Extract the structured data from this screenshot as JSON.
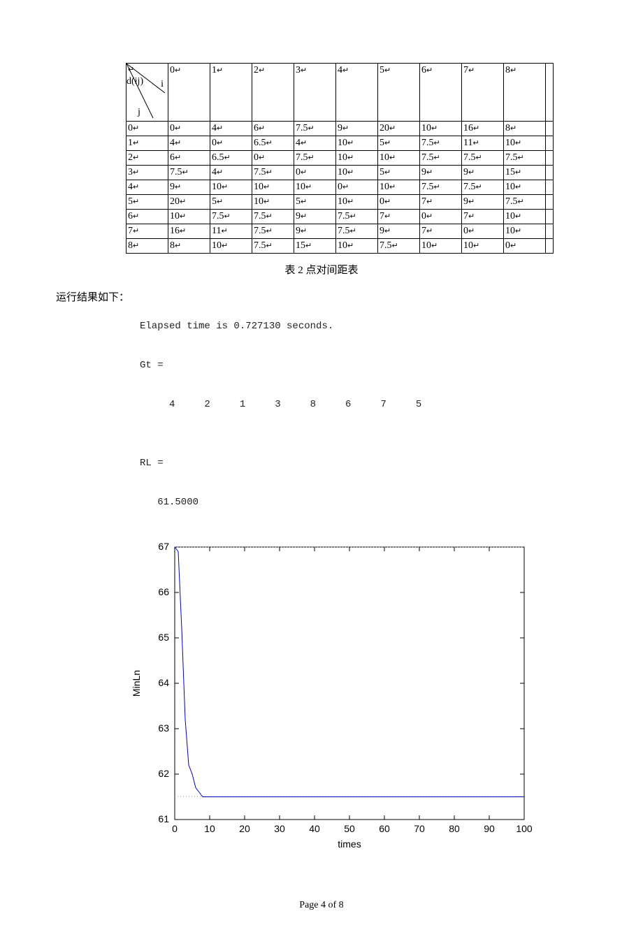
{
  "table": {
    "header_diag": {
      "dij": "d(ij)",
      "i": "i",
      "j": "j",
      "cr": "↵"
    },
    "col_headers": [
      "0",
      "1",
      "2",
      "3",
      "4",
      "5",
      "6",
      "7",
      "8"
    ],
    "rows": [
      {
        "label": "0",
        "cells": [
          "0",
          "4",
          "6",
          "7.5",
          "9",
          "20",
          "10",
          "16",
          "8"
        ]
      },
      {
        "label": "1",
        "cells": [
          "4",
          "0",
          "6.5",
          "4",
          "10",
          "5",
          "7.5",
          "11",
          "10"
        ]
      },
      {
        "label": "2",
        "cells": [
          "6",
          "6.5",
          "0",
          "7.5",
          "10",
          "10",
          "7.5",
          "7.5",
          "7.5"
        ]
      },
      {
        "label": "3",
        "cells": [
          "7.5",
          "4",
          "7.5",
          "0",
          "10",
          "5",
          "9",
          "9",
          "15"
        ]
      },
      {
        "label": "4",
        "cells": [
          "9",
          "10",
          "10",
          "10",
          "0",
          "10",
          "7.5",
          "7.5",
          "10"
        ]
      },
      {
        "label": "5",
        "cells": [
          "20",
          "5",
          "10",
          "5",
          "10",
          "0",
          "7",
          "9",
          "7.5"
        ]
      },
      {
        "label": "6",
        "cells": [
          "10",
          "7.5",
          "7.5",
          "9",
          "7.5",
          "7",
          "0",
          "7",
          "10"
        ]
      },
      {
        "label": "7",
        "cells": [
          "16",
          "11",
          "7.5",
          "9",
          "7.5",
          "9",
          "7",
          "0",
          "10"
        ]
      },
      {
        "label": "8",
        "cells": [
          "8",
          "10",
          "7.5",
          "15",
          "10",
          "7.5",
          "10",
          "10",
          "0"
        ]
      }
    ],
    "caption": "表 2  点对间距表"
  },
  "run_label": "运行结果如下：",
  "console": {
    "line1": "Elapsed time is 0.727130 seconds.",
    "gt_label": "Gt =",
    "gt_values": "     4     2     1     3     8     6     7     5",
    "rl_label": "RL =",
    "rl_value": "   61.5000"
  },
  "chart_data": {
    "type": "line",
    "xlabel": "times",
    "ylabel": "MinLn",
    "xlim": [
      0,
      100
    ],
    "ylim": [
      61,
      67
    ],
    "xticks": [
      0,
      10,
      20,
      30,
      40,
      50,
      60,
      70,
      80,
      90,
      100
    ],
    "yticks": [
      61,
      62,
      63,
      64,
      65,
      66,
      67
    ],
    "series": [
      {
        "name": "MinLn",
        "x": [
          0,
          1,
          2,
          3,
          4,
          5,
          6,
          7,
          8,
          100
        ],
        "y": [
          67,
          66.9,
          65.2,
          63.2,
          62.2,
          62.0,
          61.7,
          61.6,
          61.5,
          61.5
        ]
      }
    ]
  },
  "footer": {
    "page": "Page 4 of 8"
  }
}
